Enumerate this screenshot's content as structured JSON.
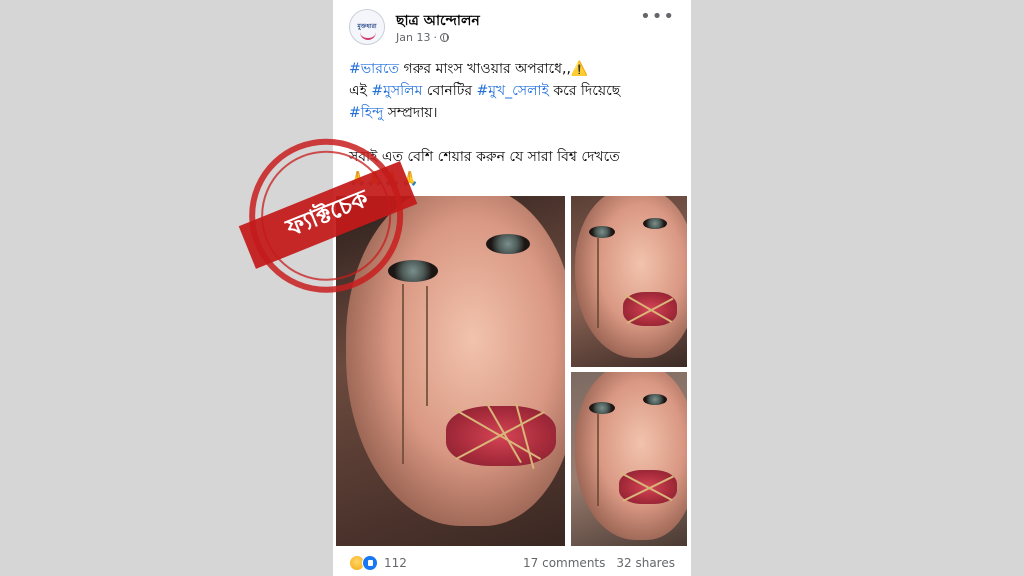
{
  "post": {
    "author": "ছাত্র আন্দোলন",
    "date": "Jan 13",
    "separator": "·",
    "privacy_icon": "globe-icon",
    "more_icon": "more-icon",
    "avatar_logo_text": "মুক্তধারা",
    "line1": {
      "tag": "#ভারতে",
      "text": " গরুর মাংস খাওয়ার অপরাধে,,",
      "icon": "⚠️"
    },
    "line2": {
      "pre": "এই ",
      "tag1": "#মুসলিম",
      "mid": " বোনটির ",
      "tag2": "#মুখ_সেলাই",
      "post": " করে দিয়েছে"
    },
    "line3": {
      "tag": "#হিন্দু",
      "text": " সম্প্রদায়।"
    },
    "line4": "সবাই এত বেশি শেয়ার করুন যে সারা বিশ্ব দেখতে",
    "line5_emoji": "🙏🙏🙏🙏"
  },
  "footer": {
    "reaction_count": "112",
    "comments": "17 comments",
    "shares": "32 shares"
  },
  "stamp": {
    "label": "ফ্যাক্টচেক",
    "color": "#c41a1a"
  },
  "colors": {
    "background": "#d6d6d6",
    "hashtag": "#216fdb",
    "meta_text": "#65676b"
  }
}
